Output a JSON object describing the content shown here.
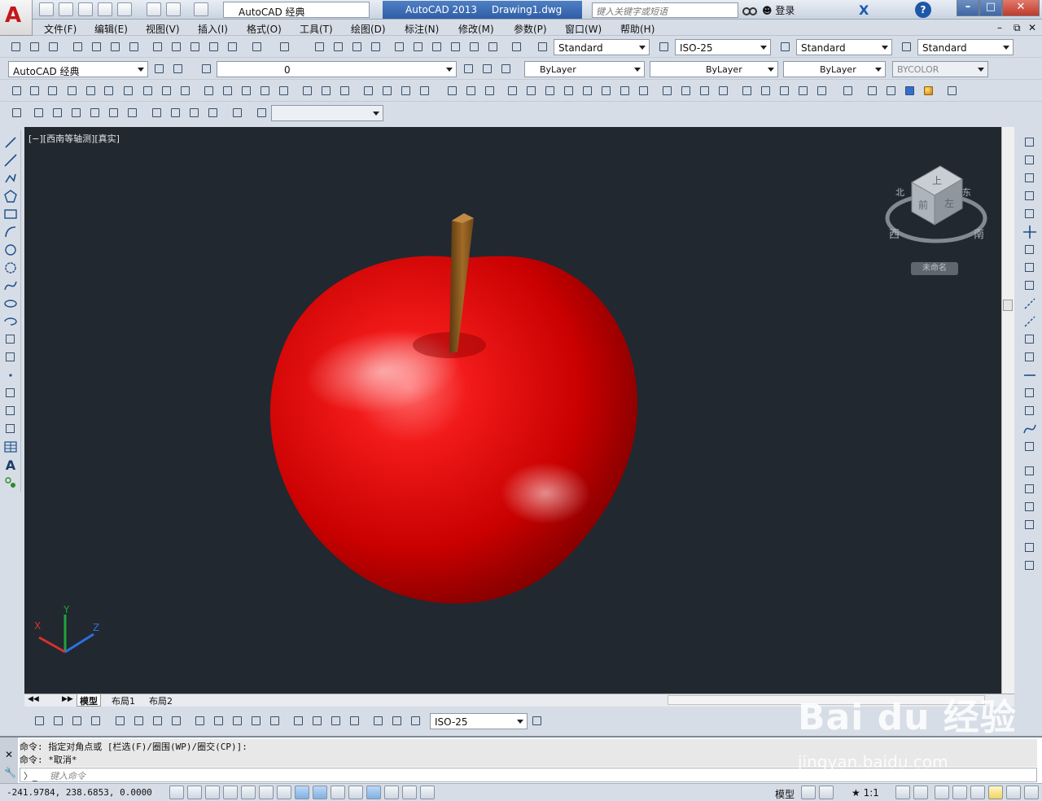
{
  "title": {
    "app": "AutoCAD 2013",
    "file": "Drawing1.dwg"
  },
  "quick_access": {
    "workspace": "AutoCAD 经典"
  },
  "search": {
    "placeholder": "键入关键字或短语"
  },
  "user": {
    "login": "登录"
  },
  "menu": [
    "文件(F)",
    "编辑(E)",
    "视图(V)",
    "插入(I)",
    "格式(O)",
    "工具(T)",
    "绘图(D)",
    "标注(N)",
    "修改(M)",
    "参数(P)",
    "窗口(W)",
    "帮助(H)"
  ],
  "styles": {
    "text_style": "Standard",
    "dim_style": "ISO-25",
    "table_style": "Standard",
    "mleader_style": "Standard"
  },
  "layers": {
    "workspace": "AutoCAD 经典",
    "current_layer": "0"
  },
  "properties": {
    "color": "ByLayer",
    "linetype": "ByLayer",
    "lineweight": "ByLayer",
    "plotstyle": "BYCOLOR"
  },
  "viewport": {
    "label": "[−][西南等轴测][真实]",
    "viewcube_faces": {
      "top": "上",
      "front": "前",
      "left": "左"
    },
    "viewcube_compass": {
      "north": "北",
      "east": "东",
      "south": "南",
      "west": "西"
    },
    "ucs_name": "未命名",
    "axis_labels": {
      "x": "X",
      "y": "Y",
      "z": "Z"
    }
  },
  "layout_tabs": [
    "模型",
    "布局1",
    "布局2"
  ],
  "dim_toolbar": {
    "dim_style": "ISO-25"
  },
  "command": {
    "history": [
      "命令: 指定对角点或 [栏选(F)/圈围(WP)/圈交(CP)]:",
      "命令: *取消*"
    ],
    "placeholder": "键入命令"
  },
  "status": {
    "coordinates": "-241.9784, 238.6853, 0.0000",
    "model_label": "模型",
    "annotation_scale": "1:1"
  },
  "colors": {
    "accent": "#2f5ea6",
    "viewport_bg": "#212830",
    "apple": "#d40000",
    "stem": "#8a5a1e"
  },
  "watermark": {
    "brand": "Bai du 经验",
    "url": "jingyan.baidu.com"
  }
}
